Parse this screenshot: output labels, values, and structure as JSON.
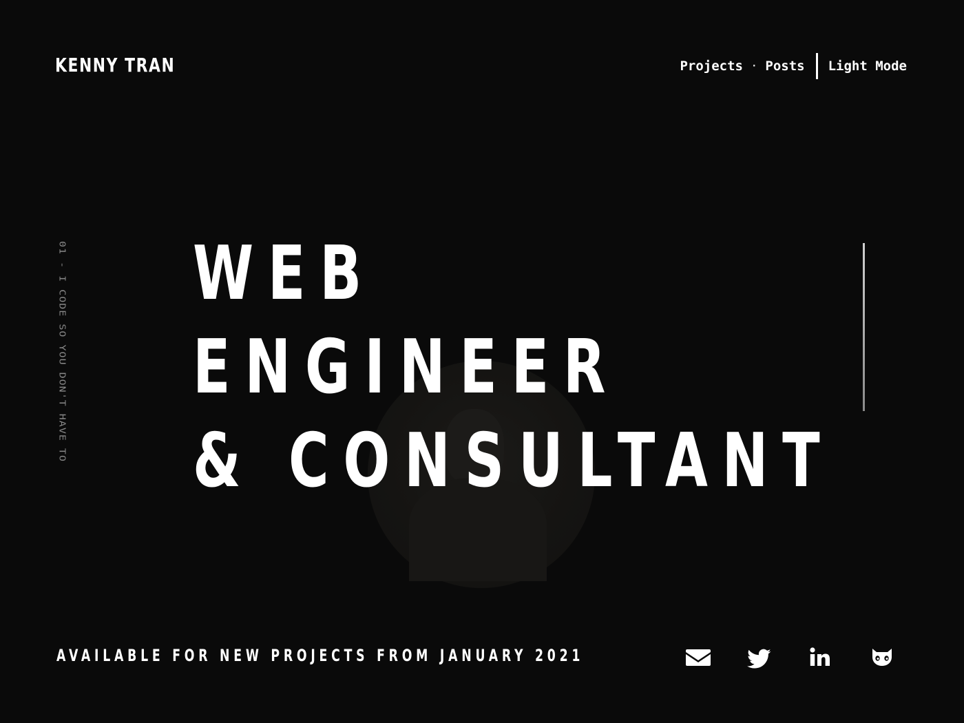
{
  "header": {
    "brand": "KENNY TRAN",
    "nav": {
      "projects": "Projects",
      "dot": "·",
      "posts": "Posts",
      "theme_toggle": "Light Mode"
    }
  },
  "hero": {
    "side_tagline": "01 - I CODE SO YOU DON'T HAVE TO",
    "title_lines": [
      "WEB",
      "ENGINEER",
      "& CONSULTANT"
    ]
  },
  "footer": {
    "availability": "AVAILABLE FOR NEW PROJECTS FROM JANUARY 2021",
    "social_icons": [
      "envelope-icon",
      "twitter-icon",
      "linkedin-icon",
      "github-icon"
    ]
  },
  "colors": {
    "background": "#0a0a0a",
    "text": "#ffffff",
    "muted": "#8a8a8a"
  }
}
